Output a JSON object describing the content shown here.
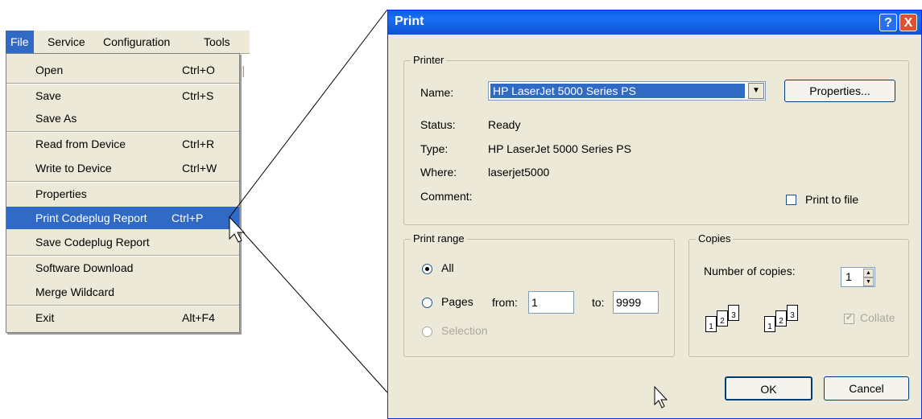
{
  "menubar": {
    "items": [
      "File",
      "Service",
      "Configuration",
      "Tools"
    ]
  },
  "file_menu": {
    "items": [
      {
        "label": "Open",
        "shortcut": "Ctrl+O"
      },
      {
        "label": "Save",
        "shortcut": "Ctrl+S"
      },
      {
        "label": "Save As",
        "shortcut": ""
      },
      {
        "label": "Read from Device",
        "shortcut": "Ctrl+R"
      },
      {
        "label": "Write to Device",
        "shortcut": "Ctrl+W"
      },
      {
        "label": "Properties",
        "shortcut": ""
      },
      {
        "label": "Print Codeplug Report",
        "shortcut": "Ctrl+P"
      },
      {
        "label": "Save Codeplug Report",
        "shortcut": ""
      },
      {
        "label": "Software Download",
        "shortcut": ""
      },
      {
        "label": "Merge Wildcard",
        "shortcut": ""
      },
      {
        "label": "Exit",
        "shortcut": "Alt+F4"
      }
    ],
    "highlighted": "Print Codeplug Report"
  },
  "print_dialog": {
    "title": "Print",
    "help_button": "?",
    "close_button": "X",
    "printer": {
      "group_label": "Printer",
      "name_label": "Name:",
      "name_value": "HP LaserJet 5000 Series PS",
      "properties_button": "Properties...",
      "status_label": "Status:",
      "status_value": "Ready",
      "type_label": "Type:",
      "type_value": "HP LaserJet 5000 Series PS",
      "where_label": "Where:",
      "where_value": "laserjet5000",
      "comment_label": "Comment:",
      "print_to_file_label": "Print to file"
    },
    "print_range": {
      "group_label": "Print range",
      "all_label": "All",
      "pages_label": "Pages",
      "from_label": "from:",
      "from_value": "1",
      "to_label": "to:",
      "to_value": "9999",
      "selection_label": "Selection"
    },
    "copies": {
      "group_label": "Copies",
      "number_label": "Number of copies:",
      "number_value": "1",
      "collate_label": "Collate",
      "collate_pages": [
        "1",
        "2",
        "3"
      ]
    },
    "ok_button": "OK",
    "cancel_button": "Cancel"
  }
}
